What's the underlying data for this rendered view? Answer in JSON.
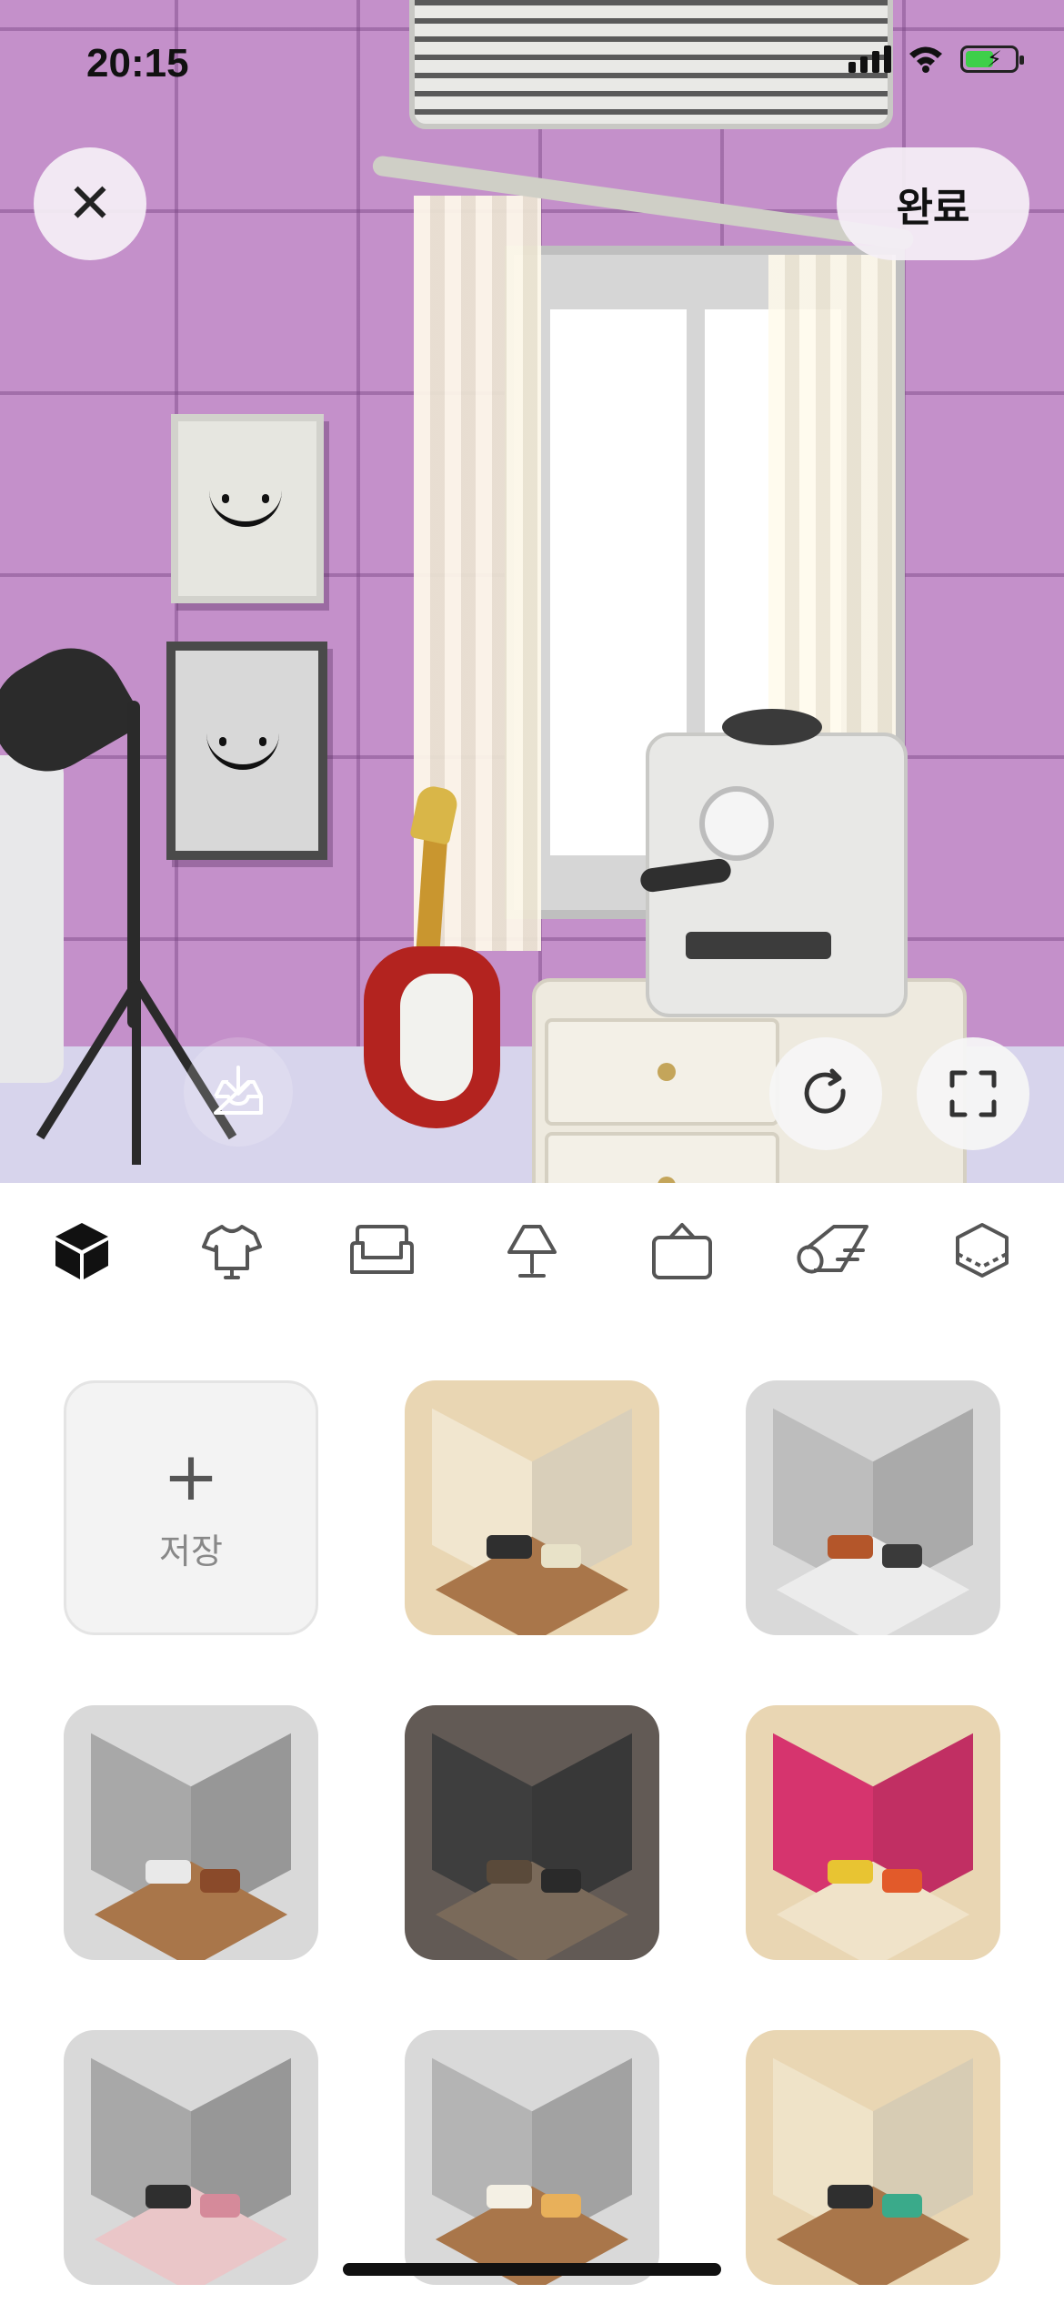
{
  "status_bar": {
    "time": "20:15",
    "icons": [
      "cellular-signal-icon",
      "wifi-icon",
      "battery-charging-icon"
    ]
  },
  "header": {
    "close_icon": "close-icon",
    "done_label": "완료"
  },
  "scene": {
    "controls": [
      "save-to-storage-icon",
      "rotate-icon",
      "fullscreen-icon"
    ],
    "wall_color": "#c490ca"
  },
  "category_tabs": [
    {
      "icon": "cube-icon",
      "active": true
    },
    {
      "icon": "shirt-icon",
      "active": false
    },
    {
      "icon": "sofa-icon",
      "active": false
    },
    {
      "icon": "lamp-icon",
      "active": false
    },
    {
      "icon": "wall-frame-icon",
      "active": false
    },
    {
      "icon": "rug-icon",
      "active": false
    },
    {
      "icon": "floor-tile-icon",
      "active": false
    }
  ],
  "presets": {
    "save_label": "저장",
    "save_icon": "plus-icon",
    "rooms": [
      {
        "bg": "#e9d6b3",
        "wall": "#f1e6cf",
        "floor": "#a9764a",
        "a": "#2f2f2f",
        "b": "#e8e2c8"
      },
      {
        "bg": "#d9d9d9",
        "wall": "#bdbdbd",
        "floor": "#ececec",
        "a": "#b4562a",
        "b": "#3a3a3a"
      },
      {
        "bg": "#d9d9d9",
        "wall": "#a8a8a8",
        "floor": "#a9764a",
        "a": "#e9e9e9",
        "b": "#8a4a2a"
      },
      {
        "bg": "#625a55",
        "wall": "#3e3e3e",
        "floor": "#7a6a5a",
        "a": "#5a4a3a",
        "b": "#2a2a2a"
      },
      {
        "bg": "#e9d6b3",
        "wall": "#d6346e",
        "floor": "#f0e3c9",
        "a": "#e8c432",
        "b": "#e25a2a"
      },
      {
        "bg": "#d9d9d9",
        "wall": "#a8a8a8",
        "floor": "#eac6c8",
        "a": "#2f2f2f",
        "b": "#d58a9a"
      },
      {
        "bg": "#d9d9d9",
        "wall": "#b4b4b4",
        "floor": "#a9764a",
        "a": "#f4f0e4",
        "b": "#e8b05a"
      },
      {
        "bg": "#e9d6b3",
        "wall": "#efe3c8",
        "floor": "#a9764a",
        "a": "#2f2f2f",
        "b": "#3aaa8a"
      }
    ]
  },
  "colors": {
    "accent": "#111111",
    "tab_inactive": "#555555"
  }
}
